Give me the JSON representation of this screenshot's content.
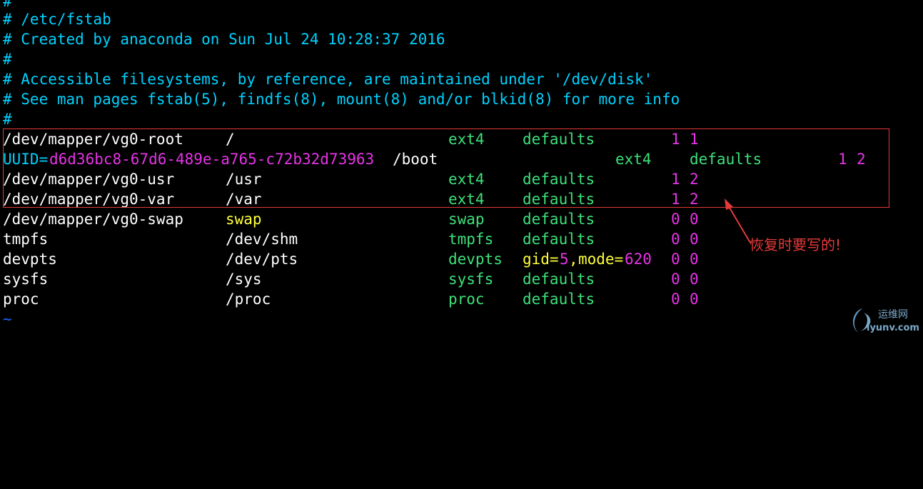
{
  "colors": {
    "background": "#000000",
    "comment": "#00d2ff",
    "device": "#ffffff",
    "uuid_key": "#00d2ff",
    "uuid_value": "#e733e7",
    "fstype": "#3ee07a",
    "options": "#3ee07a",
    "numbers": "#e733e7",
    "special": "#ffff3a",
    "annotation": "#e53a3a"
  },
  "comments": [
    "#",
    "# /etc/fstab",
    "# Created by anaconda on Sun Jul 24 10:28:37 2016",
    "#",
    "# Accessible filesystems, by reference, are maintained under '/dev/disk'",
    "# See man pages fstab(5), findfs(8), mount(8) and/or blkid(8) for more info",
    "#"
  ],
  "entries": [
    {
      "device": "/dev/mapper/vg0-root",
      "mount": "/",
      "fstype": "ext4",
      "options": "defaults",
      "dump": "1",
      "pass": "1"
    },
    {
      "uuid_key": "UUID=",
      "uuid_value": "d6d36bc8-67d6-489e-a765-c72b32d73963",
      "mount": "/boot",
      "fstype": "ext4",
      "options": "defaults",
      "dump": "1",
      "pass": "2"
    },
    {
      "device": "/dev/mapper/vg0-usr",
      "mount": "/usr",
      "fstype": "ext4",
      "options": "defaults",
      "dump": "1",
      "pass": "2"
    },
    {
      "device": "/dev/mapper/vg0-var",
      "mount": "/var",
      "fstype": "ext4",
      "options": "defaults",
      "dump": "1",
      "pass": "2"
    },
    {
      "device": "/dev/mapper/vg0-swap",
      "mount": "swap",
      "fstype": "swap",
      "options": "defaults",
      "dump": "0",
      "pass": "0"
    },
    {
      "device": "tmpfs",
      "mount": "/dev/shm",
      "fstype": "tmpfs",
      "options": "defaults",
      "dump": "0",
      "pass": "0"
    },
    {
      "device": "devpts",
      "mount": "/dev/pts",
      "fstype": "devpts",
      "options_gid_key": "gid=",
      "options_gid_val": "5",
      "options_sep": ",",
      "options_mode_key": "mode=",
      "options_mode_val": "620",
      "dump": "0",
      "pass": "0"
    },
    {
      "device": "sysfs",
      "mount": "/sys",
      "fstype": "sysfs",
      "options": "defaults",
      "dump": "0",
      "pass": "0"
    },
    {
      "device": "proc",
      "mount": "/proc",
      "fstype": "proc",
      "options": "defaults",
      "dump": "0",
      "pass": "0"
    }
  ],
  "empty_line_marker": "~",
  "annotation": {
    "text": "恢复时要写的!"
  },
  "watermark": {
    "site_name": "运维网",
    "url": "iyunv.com"
  }
}
